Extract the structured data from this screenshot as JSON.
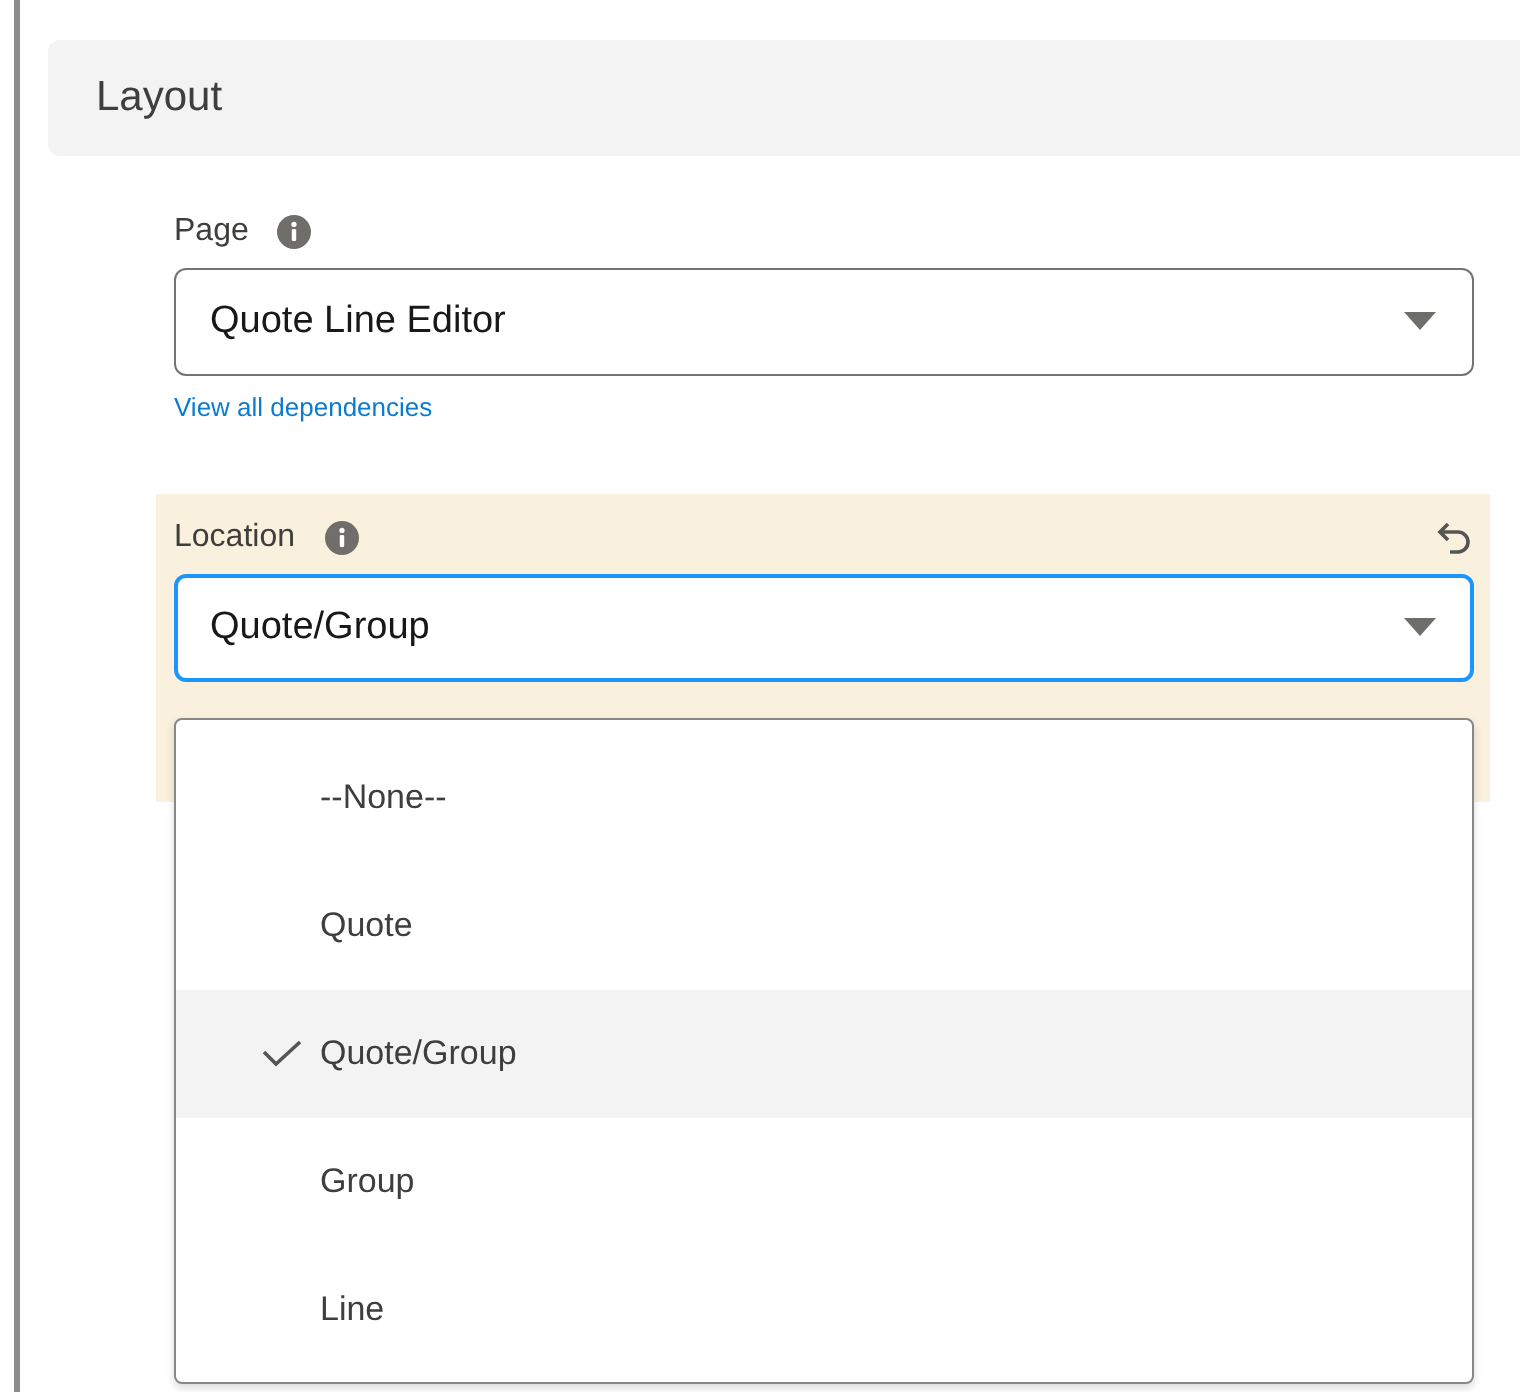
{
  "section": {
    "title": "Layout"
  },
  "page_field": {
    "label": "Page",
    "value": "Quote Line Editor",
    "link": "View all dependencies"
  },
  "location_field": {
    "label": "Location",
    "value": "Quote/Group",
    "modified": true,
    "focused": true
  },
  "dropdown": {
    "options": [
      {
        "label": "--None--",
        "selected": false
      },
      {
        "label": "Quote",
        "selected": false
      },
      {
        "label": "Quote/Group",
        "selected": true
      },
      {
        "label": "Group",
        "selected": false
      },
      {
        "label": "Line",
        "selected": false
      }
    ]
  }
}
